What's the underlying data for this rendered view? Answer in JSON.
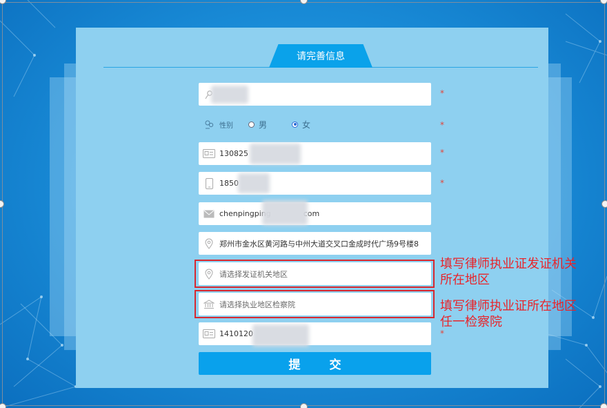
{
  "form": {
    "title": "请完善信息",
    "required_mark": "*",
    "name": {
      "value": ""
    },
    "gender": {
      "label": "性别",
      "options": [
        {
          "label": "男",
          "selected": false
        },
        {
          "label": "女",
          "selected": true
        }
      ]
    },
    "id_card": {
      "value": "130825"
    },
    "phone": {
      "value": "1850"
    },
    "email": {
      "value_start": "chenpingping",
      "value_end": "com"
    },
    "address": {
      "value": "郑州市金水区黄河路与中州大道交叉口金成时代广场9号楼8"
    },
    "issuing_region": {
      "placeholder": "请选择发证机关地区"
    },
    "practice_procuratorate": {
      "placeholder": "请选择执业地区检察院"
    },
    "license_no": {
      "value": "1410120"
    },
    "submit_label": "提 交"
  },
  "annotations": {
    "issuing_region_note": [
      "填写律师执业证发证机关",
      "所在地区"
    ],
    "procuratorate_note": [
      "填写律师执业证所在地区",
      "任一检察院"
    ]
  },
  "icons": {
    "name": "user-icon",
    "gender": "gender-icon",
    "id_card": "id-card-icon",
    "phone": "mobile-phone-icon",
    "email": "envelope-icon",
    "address": "location-pin-icon",
    "issuing_region": "location-pin-icon",
    "practice_procuratorate": "institution-building-icon",
    "license_no": "id-card-icon"
  },
  "colors": {
    "panel": "#8ed0f0",
    "accent": "#09a1ec",
    "required": "#e3463a",
    "annotation": "#e8242a"
  }
}
